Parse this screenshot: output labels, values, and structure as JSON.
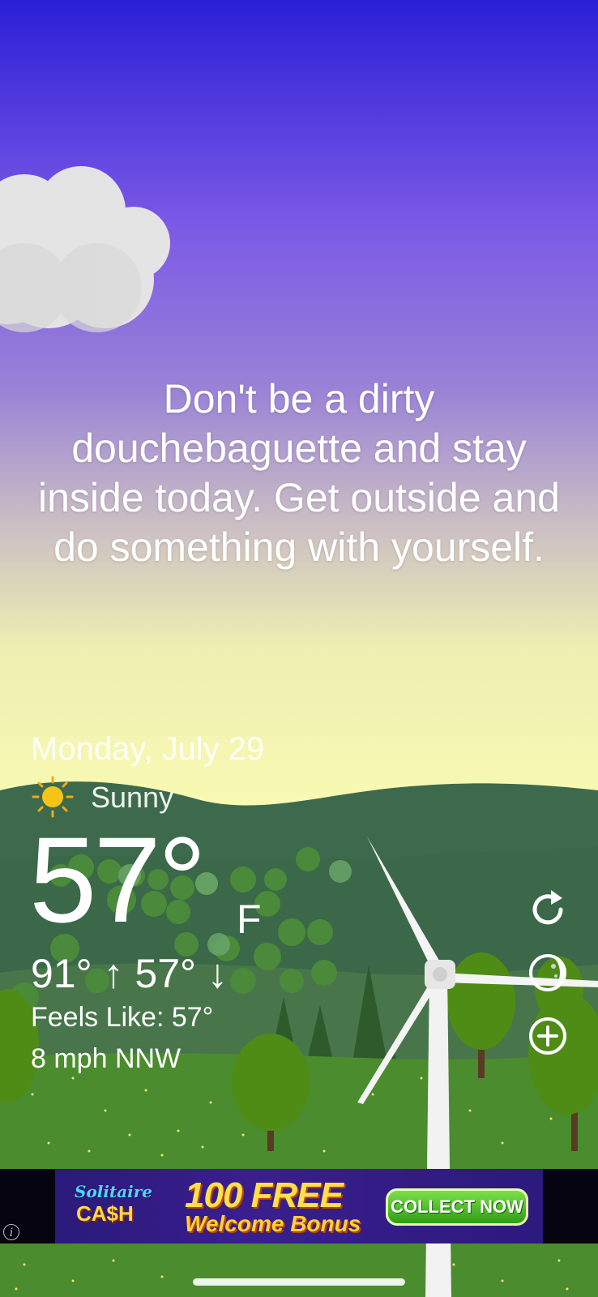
{
  "message": "Don't be a dirty douchebaguette and stay inside today. Get outside and do something with yourself.",
  "weather": {
    "date": "Monday, July 29",
    "condition": "Sunny",
    "condition_icon": "sun-icon",
    "temperature": "57°",
    "unit": "F",
    "high_low": "91° ↑  57° ↓",
    "feels_like": "Feels Like: 57°",
    "wind": "8 mph NNW"
  },
  "controls": {
    "refresh_icon": "refresh-icon",
    "theme_icon": "moon-toggle-icon",
    "add_icon": "add-location-icon"
  },
  "ad": {
    "logo_line1": "Solitaire",
    "logo_line2": "CA$H",
    "headline": "100 FREE",
    "subline": "Welcome Bonus",
    "button": "COLLECT NOW",
    "info": "i"
  },
  "colors": {
    "sky_top": "#2a1fd6",
    "sky_mid": "#8f6fd8",
    "sky_bottom": "#f7f9b3",
    "hills": "#3d6a4c",
    "grass": "#4a8c2e"
  }
}
